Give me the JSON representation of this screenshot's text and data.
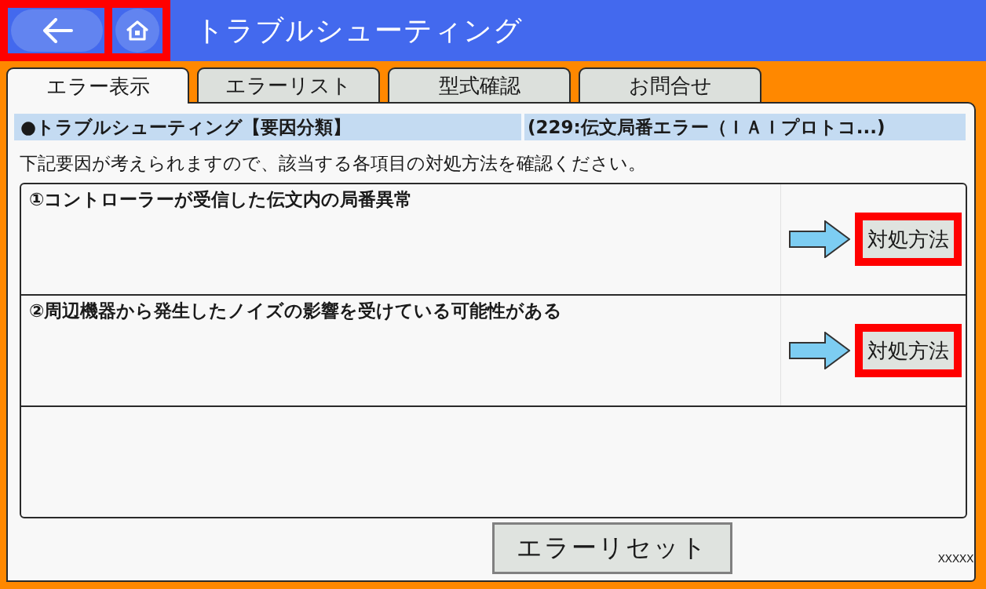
{
  "header": {
    "buttons": [
      {
        "kind": "back",
        "highlighted": true
      },
      {
        "kind": "home",
        "highlighted": true
      }
    ],
    "title": "トラブルシューティング"
  },
  "tabs": [
    {
      "label": "エラー表示",
      "selected": true
    },
    {
      "label": "エラーリスト",
      "selected": false
    },
    {
      "label": "型式確認",
      "selected": false
    },
    {
      "label": "お問合せ",
      "selected": false
    }
  ],
  "section_bar": {
    "title": "●トラブルシューティング【要因分類】",
    "error": "(229:伝文局番エラー（ＩＡＩプロトコ...)"
  },
  "instruction": "下記要因が考えられますので、該当する各項目の対処方法を確認ください。",
  "causes": [
    {
      "text": "①コントローラーが受信した伝文内の局番異常",
      "action": {
        "label": "対処方法",
        "highlighted": true
      }
    },
    {
      "text": "②周辺機器から発生したノイズの影響を受けている可能性がある",
      "action": {
        "label": "対処方法",
        "highlighted": true
      }
    }
  ],
  "reset_button": "エラーリセット",
  "footer_code": "XXXXX"
}
